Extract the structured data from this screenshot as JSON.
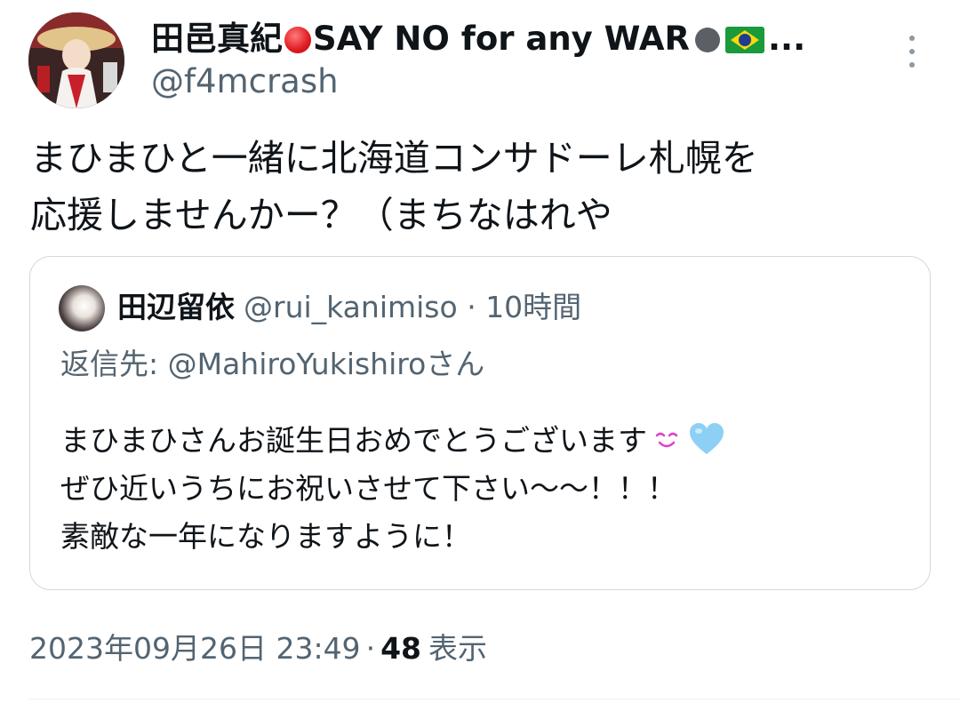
{
  "author": {
    "display_name_prefix": "田邑真紀",
    "display_name_middle": "SAY NO for any WAR",
    "display_name_suffix": "...",
    "handle": "@f4mcrash",
    "avatar_icon": "profile-photo-icon"
  },
  "menu": {
    "more_icon": "more-vertical-icon"
  },
  "tweet": {
    "text_line1": "まひまひと一緒に北海道コンサドーレ札幌を",
    "text_line2": "応援しませんかー？（まちなはれや"
  },
  "quote": {
    "name": "田辺留依",
    "handle": "@rui_kanimiso",
    "separator": "·",
    "time": "10時間",
    "reply_prefix": "返信先: ",
    "reply_to": "@MahiroYukishiro",
    "reply_suffix": "さん",
    "body_line1": "まひまひさんお誕生日おめでとうございます",
    "body_line2": "ぜひ近いうちにお祝いさせて下さい〜〜！！！",
    "body_line3": "素敵な一年になりますように！"
  },
  "footer": {
    "date": "2023年09月26日 23:49",
    "separator": "·",
    "views_count": "48",
    "views_label": "表示"
  },
  "colors": {
    "text_primary": "#0f1419",
    "text_secondary": "#536471",
    "border": "#cfd9de",
    "heart": "#8ed0f5",
    "smile": "#e040c8"
  }
}
